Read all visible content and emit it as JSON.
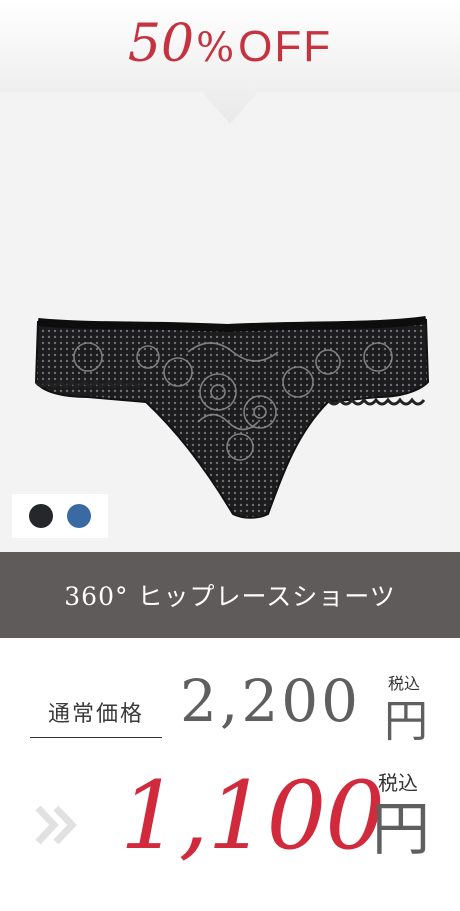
{
  "banner": {
    "discount_number": "50",
    "percent_sign": "%",
    "off_label": "OFF",
    "text_color": "#c4333f"
  },
  "product": {
    "image_icon": "lace-panties-image",
    "name": "360° ヒップレースショーツ"
  },
  "color_options": {
    "swatches": [
      {
        "name": "black",
        "color": "#25272a"
      },
      {
        "name": "blue",
        "color": "#3a6aa3"
      }
    ]
  },
  "pricing": {
    "regular_label": "通常価格",
    "regular_price": "2,200",
    "regular_currency": "円",
    "regular_tax_label": "税込",
    "sale_arrow_icon": "double-chevron-right-icon",
    "sale_price": "1,100",
    "sale_currency": "円",
    "sale_tax_label": "税込",
    "sale_color": "#d12a3c"
  }
}
